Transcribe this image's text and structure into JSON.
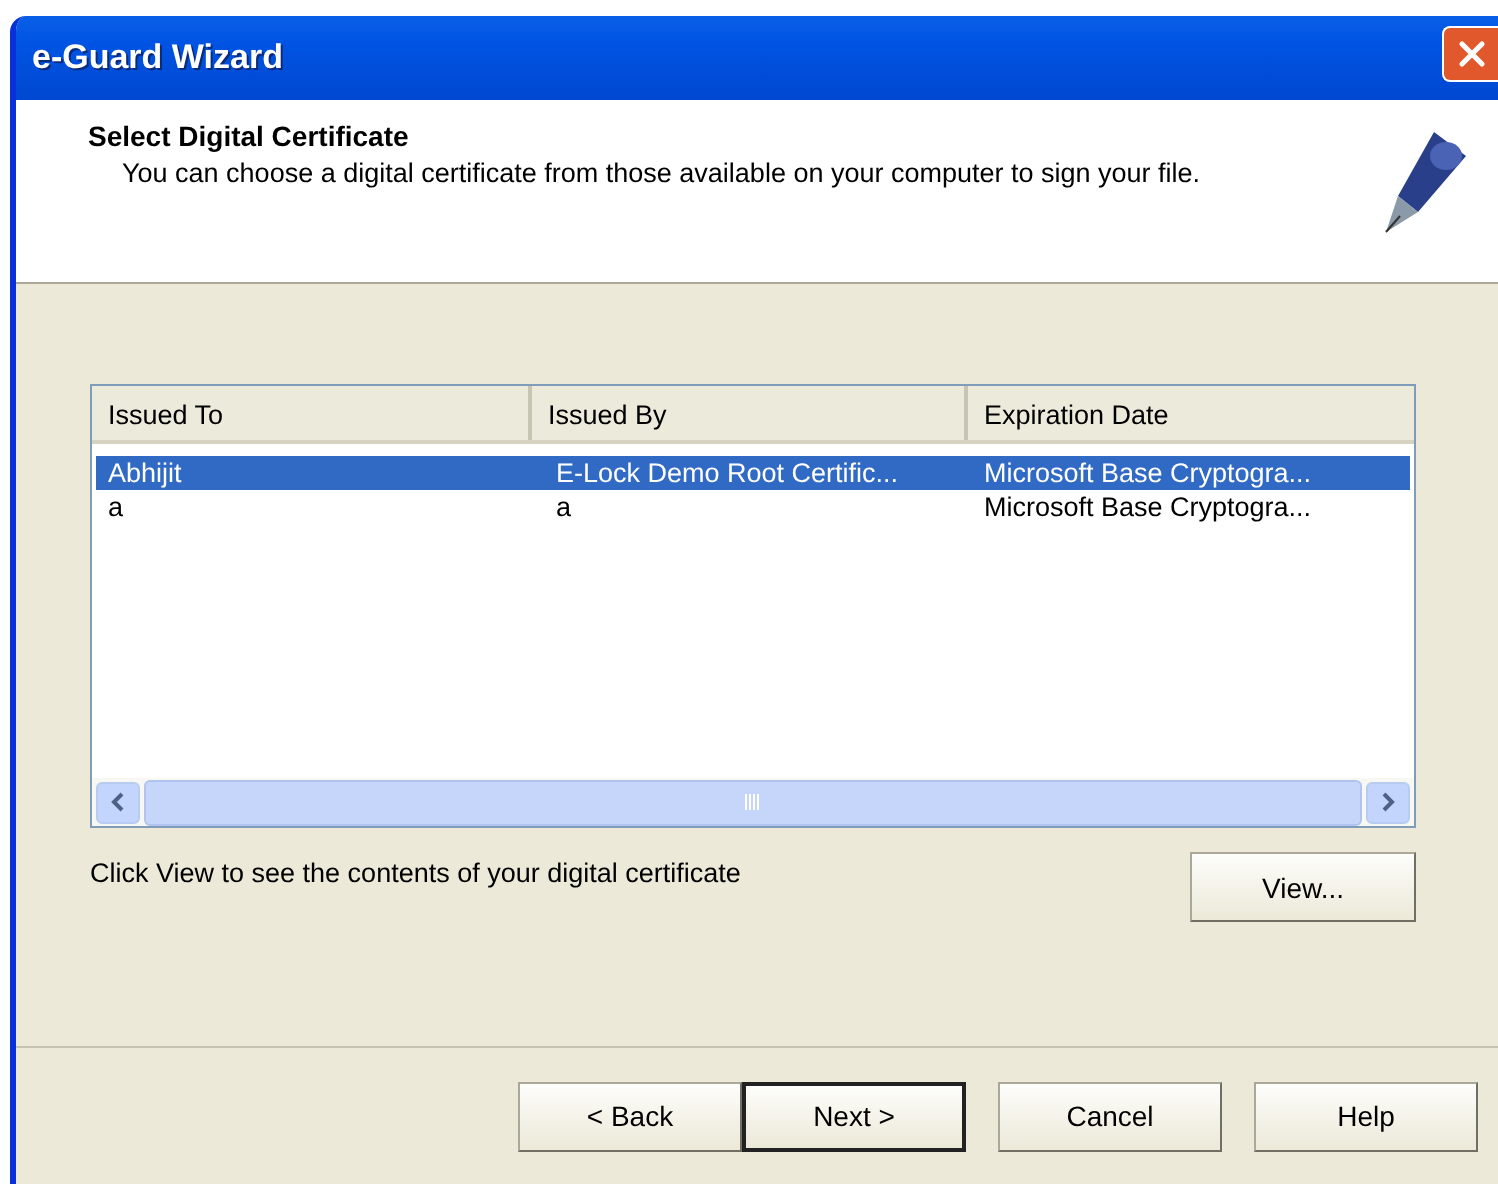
{
  "window": {
    "title": "e-Guard Wizard"
  },
  "header": {
    "title": "Select Digital Certificate",
    "subtitle": "You can choose a digital certificate from those available on your computer to sign your file."
  },
  "table": {
    "columns": [
      "Issued To",
      "Issued By",
      "Expiration Date"
    ],
    "rows": [
      {
        "cells": [
          "Abhijit",
          "E-Lock Demo Root Certific...",
          "Microsoft Base Cryptogra..."
        ],
        "selected": true
      },
      {
        "cells": [
          "a",
          "a",
          "Microsoft Base Cryptogra..."
        ],
        "selected": false
      }
    ]
  },
  "hint": "Click View to see the contents of your digital certificate",
  "view_button": "View...",
  "buttons": [
    {
      "label": "< Back",
      "default": false
    },
    {
      "label": "Next >",
      "default": true
    },
    {
      "label": "Cancel",
      "default": false
    },
    {
      "label": "Help",
      "default": false
    }
  ]
}
